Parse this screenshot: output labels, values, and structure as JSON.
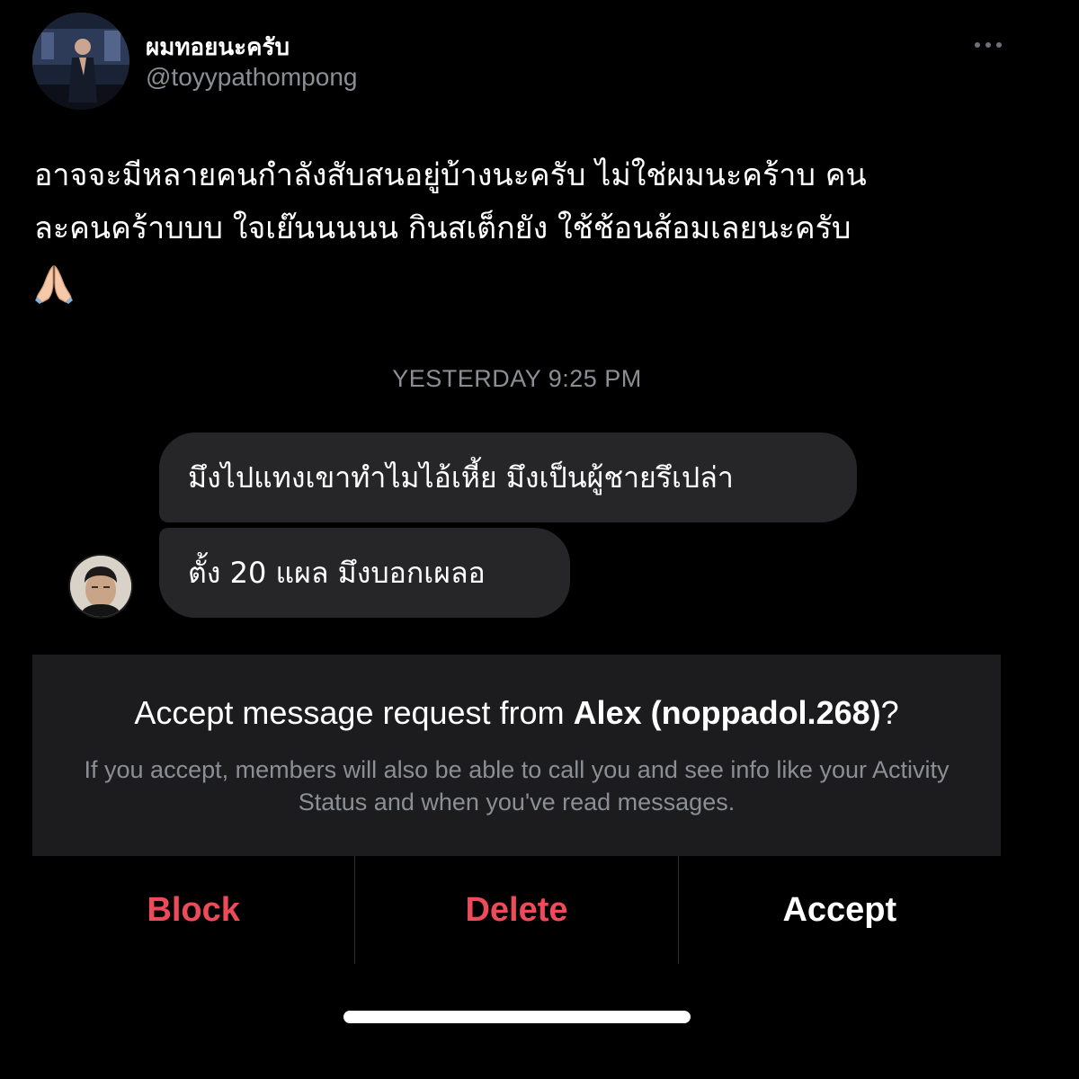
{
  "tweet": {
    "display_name": "ผมทอยนะครับ",
    "handle": "@toyypathompong",
    "lines": [
      "อาจจะมีหลายคนกำลังสับสนอยู่บ้างนะครับ ไม่ใช่ผมนะคร้าบ คน",
      "ละคนคร้าบบบ ใจเย๊นนนนน กินสเต็กยัง ใช้ช้อนส้อมเลยนะครับ"
    ],
    "emoji_icon": "folded-hands-icon",
    "more_icon": "more-options-icon"
  },
  "conversation": {
    "timestamp": "YESTERDAY 9:25 PM",
    "messages": [
      "มึงไปแทงเขาทำไมไอ้เหี้ย มึงเป็นผู้ชายรึเปล่า",
      "ตั้ง 20 แผล มึงบอกเผลอ"
    ]
  },
  "request": {
    "title_prefix": "Accept message request from ",
    "title_name": "Alex (noppadol.268)",
    "title_suffix": "?",
    "description": "If you accept, members will also be able to call you and see info like your Activity Status and when you've read messages.",
    "block_label": "Block",
    "delete_label": "Delete",
    "accept_label": "Accept"
  },
  "colors": {
    "background": "#000000",
    "bubble": "#262628",
    "panel": "#1c1c1e",
    "danger": "#ed4a5a",
    "muted": "#8b8f95"
  }
}
